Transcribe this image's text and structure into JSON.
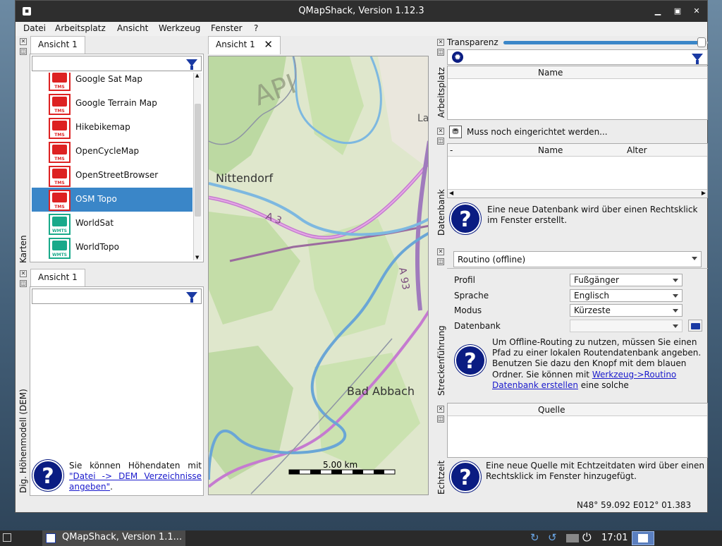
{
  "window": {
    "title": "QMapShack, Version 1.12.3"
  },
  "menu": [
    "Datei",
    "Arbeitsplatz",
    "Ansicht",
    "Werkzeug",
    "Fenster",
    "?"
  ],
  "maps_dock": {
    "tab": "Ansicht 1",
    "side_label": "Karten",
    "items": [
      {
        "label": "Google Sat Map",
        "type": "TMS"
      },
      {
        "label": "Google Terrain Map",
        "type": "TMS"
      },
      {
        "label": "Hikebikemap",
        "type": "TMS"
      },
      {
        "label": "OpenCycleMap",
        "type": "TMS"
      },
      {
        "label": "OpenStreetBrowser",
        "type": "TMS"
      },
      {
        "label": "OSM Topo",
        "type": "TMS",
        "selected": true
      },
      {
        "label": "WorldSat",
        "type": "WMTS"
      },
      {
        "label": "WorldTopo",
        "type": "WMTS"
      }
    ]
  },
  "dem_dock": {
    "tab": "Ansicht 1",
    "side_label": "Dig. Höhenmodell (DEM)",
    "info_text": "Sie können Höhendaten mit ",
    "info_link": "\"Datei -> DEM Verzeichnisse angeben\"",
    "info_tail": "."
  },
  "map_view": {
    "tab": "Ansicht 1",
    "labels": {
      "nittendorf": "Nittendorf",
      "bad_abbach": "Bad Abbach",
      "a3": "A 3",
      "a93": "A 93",
      "la": "La",
      "api": "API"
    },
    "scale": "5.00 km"
  },
  "workspace": {
    "transparency_label": "Transparenz",
    "transparency_value": 0.97,
    "side_label": "Arbeitsplatz",
    "col_name": "Name"
  },
  "database": {
    "side_label": "Datenbank",
    "status": "Muss noch eingerichtet werden...",
    "cols": [
      "-",
      "Name",
      "Alter"
    ],
    "info": "Eine neue Datenbank wird über einen Rechtsklick im Fenster erstellt."
  },
  "routing": {
    "side_label": "Streckenführung",
    "engine": "Routino (offline)",
    "rows": [
      {
        "label": "Profil",
        "value": "Fußgänger"
      },
      {
        "label": "Sprache",
        "value": "Englisch"
      },
      {
        "label": "Modus",
        "value": "Kürzeste"
      },
      {
        "label": "Datenbank",
        "value": ""
      }
    ],
    "info_text": "Um Offline-Routing zu nutzen, müssen Sie einen Pfad zu einer lokalen Routendatenbank angeben. Benutzen Sie dazu den Knopf mit dem blauen Ordner. Sie können mit ",
    "info_link": "Werkzeug->Routino Datenbank erstellen",
    "info_tail": " eine solche"
  },
  "realtime": {
    "side_label": "Echtzeit",
    "col": "Quelle",
    "info": "Eine neue Quelle mit Echtzeitdaten wird über einen Rechtsklick im Fenster hinzugefügt."
  },
  "statusbar": {
    "coords": "N48° 59.092 E012° 01.383"
  },
  "taskbar": {
    "app": "QMapShack, Version 1.1...",
    "clock": "17:01"
  }
}
